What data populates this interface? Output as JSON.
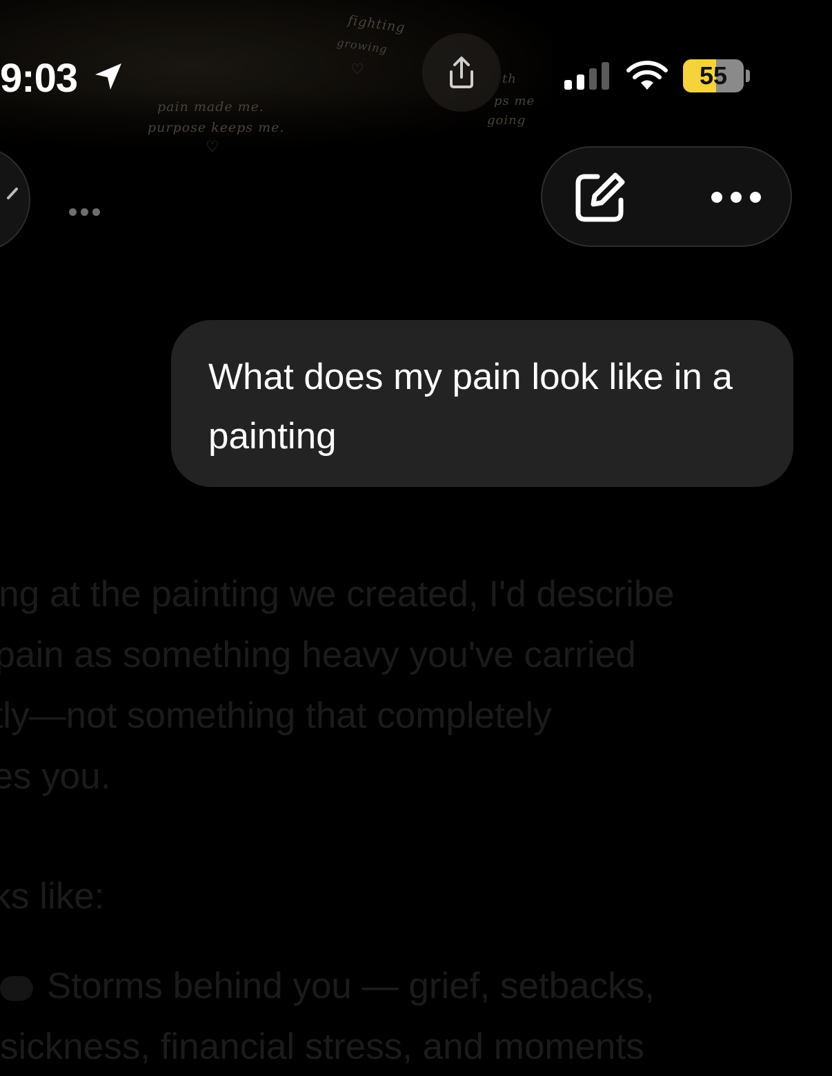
{
  "status_bar": {
    "time": "9:03",
    "battery": "55",
    "battery_level": 0.55
  },
  "background_art": {
    "lines": [
      "pain made me.",
      "purpose keeps me."
    ],
    "words": [
      "fighting",
      "growing"
    ],
    "fragments": [
      "th",
      "ps me",
      "going"
    ]
  },
  "toolbar": {
    "compose_icon": "compose-icon",
    "more_icon": "more-horizontal-icon"
  },
  "user_message": {
    "text": "What does my pain look like in a painting"
  },
  "assistant_reply": {
    "lines": [
      "king at the painting we created, I'd describe",
      "r pain as something heavy you've carried",
      "etly—not something that completely",
      "nes you."
    ],
    "label": "oks like:",
    "storm_line_1": "Storms behind you — grief, setbacks,",
    "storm_line_2": "sickness, financial stress, and moments"
  }
}
